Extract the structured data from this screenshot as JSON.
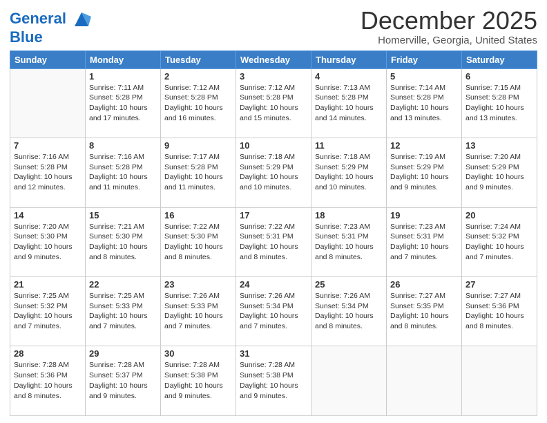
{
  "logo": {
    "line1": "General",
    "line2": "Blue"
  },
  "title": "December 2025",
  "location": "Homerville, Georgia, United States",
  "days_of_week": [
    "Sunday",
    "Monday",
    "Tuesday",
    "Wednesday",
    "Thursday",
    "Friday",
    "Saturday"
  ],
  "weeks": [
    [
      {
        "day": "",
        "info": ""
      },
      {
        "day": "1",
        "info": "Sunrise: 7:11 AM\nSunset: 5:28 PM\nDaylight: 10 hours\nand 17 minutes."
      },
      {
        "day": "2",
        "info": "Sunrise: 7:12 AM\nSunset: 5:28 PM\nDaylight: 10 hours\nand 16 minutes."
      },
      {
        "day": "3",
        "info": "Sunrise: 7:12 AM\nSunset: 5:28 PM\nDaylight: 10 hours\nand 15 minutes."
      },
      {
        "day": "4",
        "info": "Sunrise: 7:13 AM\nSunset: 5:28 PM\nDaylight: 10 hours\nand 14 minutes."
      },
      {
        "day": "5",
        "info": "Sunrise: 7:14 AM\nSunset: 5:28 PM\nDaylight: 10 hours\nand 13 minutes."
      },
      {
        "day": "6",
        "info": "Sunrise: 7:15 AM\nSunset: 5:28 PM\nDaylight: 10 hours\nand 13 minutes."
      }
    ],
    [
      {
        "day": "7",
        "info": "Sunrise: 7:16 AM\nSunset: 5:28 PM\nDaylight: 10 hours\nand 12 minutes."
      },
      {
        "day": "8",
        "info": "Sunrise: 7:16 AM\nSunset: 5:28 PM\nDaylight: 10 hours\nand 11 minutes."
      },
      {
        "day": "9",
        "info": "Sunrise: 7:17 AM\nSunset: 5:28 PM\nDaylight: 10 hours\nand 11 minutes."
      },
      {
        "day": "10",
        "info": "Sunrise: 7:18 AM\nSunset: 5:29 PM\nDaylight: 10 hours\nand 10 minutes."
      },
      {
        "day": "11",
        "info": "Sunrise: 7:18 AM\nSunset: 5:29 PM\nDaylight: 10 hours\nand 10 minutes."
      },
      {
        "day": "12",
        "info": "Sunrise: 7:19 AM\nSunset: 5:29 PM\nDaylight: 10 hours\nand 9 minutes."
      },
      {
        "day": "13",
        "info": "Sunrise: 7:20 AM\nSunset: 5:29 PM\nDaylight: 10 hours\nand 9 minutes."
      }
    ],
    [
      {
        "day": "14",
        "info": "Sunrise: 7:20 AM\nSunset: 5:30 PM\nDaylight: 10 hours\nand 9 minutes."
      },
      {
        "day": "15",
        "info": "Sunrise: 7:21 AM\nSunset: 5:30 PM\nDaylight: 10 hours\nand 8 minutes."
      },
      {
        "day": "16",
        "info": "Sunrise: 7:22 AM\nSunset: 5:30 PM\nDaylight: 10 hours\nand 8 minutes."
      },
      {
        "day": "17",
        "info": "Sunrise: 7:22 AM\nSunset: 5:31 PM\nDaylight: 10 hours\nand 8 minutes."
      },
      {
        "day": "18",
        "info": "Sunrise: 7:23 AM\nSunset: 5:31 PM\nDaylight: 10 hours\nand 8 minutes."
      },
      {
        "day": "19",
        "info": "Sunrise: 7:23 AM\nSunset: 5:31 PM\nDaylight: 10 hours\nand 7 minutes."
      },
      {
        "day": "20",
        "info": "Sunrise: 7:24 AM\nSunset: 5:32 PM\nDaylight: 10 hours\nand 7 minutes."
      }
    ],
    [
      {
        "day": "21",
        "info": "Sunrise: 7:25 AM\nSunset: 5:32 PM\nDaylight: 10 hours\nand 7 minutes."
      },
      {
        "day": "22",
        "info": "Sunrise: 7:25 AM\nSunset: 5:33 PM\nDaylight: 10 hours\nand 7 minutes."
      },
      {
        "day": "23",
        "info": "Sunrise: 7:26 AM\nSunset: 5:33 PM\nDaylight: 10 hours\nand 7 minutes."
      },
      {
        "day": "24",
        "info": "Sunrise: 7:26 AM\nSunset: 5:34 PM\nDaylight: 10 hours\nand 7 minutes."
      },
      {
        "day": "25",
        "info": "Sunrise: 7:26 AM\nSunset: 5:34 PM\nDaylight: 10 hours\nand 8 minutes."
      },
      {
        "day": "26",
        "info": "Sunrise: 7:27 AM\nSunset: 5:35 PM\nDaylight: 10 hours\nand 8 minutes."
      },
      {
        "day": "27",
        "info": "Sunrise: 7:27 AM\nSunset: 5:36 PM\nDaylight: 10 hours\nand 8 minutes."
      }
    ],
    [
      {
        "day": "28",
        "info": "Sunrise: 7:28 AM\nSunset: 5:36 PM\nDaylight: 10 hours\nand 8 minutes."
      },
      {
        "day": "29",
        "info": "Sunrise: 7:28 AM\nSunset: 5:37 PM\nDaylight: 10 hours\nand 9 minutes."
      },
      {
        "day": "30",
        "info": "Sunrise: 7:28 AM\nSunset: 5:38 PM\nDaylight: 10 hours\nand 9 minutes."
      },
      {
        "day": "31",
        "info": "Sunrise: 7:28 AM\nSunset: 5:38 PM\nDaylight: 10 hours\nand 9 minutes."
      },
      {
        "day": "",
        "info": ""
      },
      {
        "day": "",
        "info": ""
      },
      {
        "day": "",
        "info": ""
      }
    ]
  ]
}
